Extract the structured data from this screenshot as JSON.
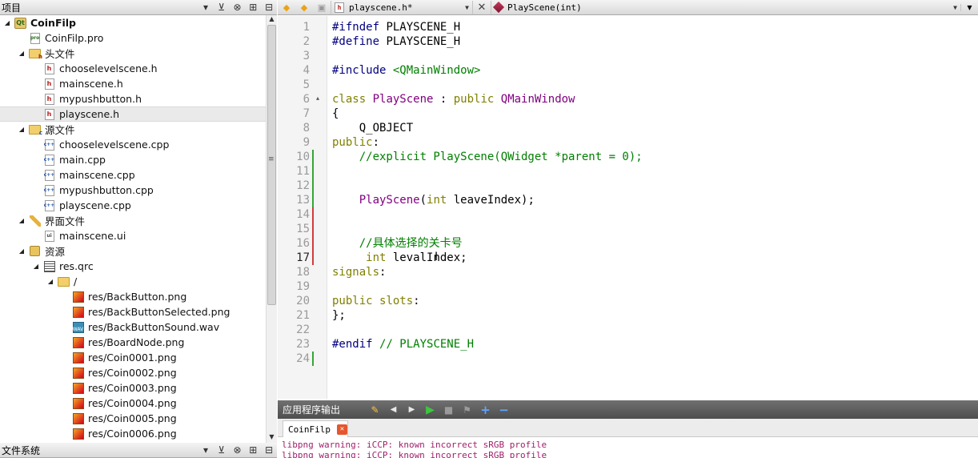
{
  "projects_panel": {
    "title": "项目",
    "tree": [
      {
        "label": "CoinFilp",
        "icon": "project-icon",
        "expanded": true
      },
      {
        "label": "CoinFilp.pro",
        "icon": "pro-file-icon"
      },
      {
        "label": "头文件",
        "icon": "headers-folder-icon",
        "expanded": true
      },
      {
        "label": "chooselevelscene.h",
        "icon": "header-file-icon"
      },
      {
        "label": "mainscene.h",
        "icon": "header-file-icon"
      },
      {
        "label": "mypushbutton.h",
        "icon": "header-file-icon"
      },
      {
        "label": "playscene.h",
        "icon": "header-file-icon",
        "selected": true
      },
      {
        "label": "源文件",
        "icon": "sources-folder-icon",
        "expanded": true
      },
      {
        "label": "chooselevelscene.cpp",
        "icon": "cpp-file-icon"
      },
      {
        "label": "main.cpp",
        "icon": "cpp-file-icon"
      },
      {
        "label": "mainscene.cpp",
        "icon": "cpp-file-icon"
      },
      {
        "label": "mypushbutton.cpp",
        "icon": "cpp-file-icon"
      },
      {
        "label": "playscene.cpp",
        "icon": "cpp-file-icon"
      },
      {
        "label": "界面文件",
        "icon": "forms-folder-icon",
        "expanded": true
      },
      {
        "label": "mainscene.ui",
        "icon": "ui-file-icon"
      },
      {
        "label": "资源",
        "icon": "resources-folder-icon",
        "expanded": true
      },
      {
        "label": "res.qrc",
        "icon": "qrc-file-icon",
        "expanded": true
      },
      {
        "label": "/",
        "icon": "folder-icon",
        "expanded": true
      },
      {
        "label": "res/BackButton.png",
        "icon": "png-file-icon"
      },
      {
        "label": "res/BackButtonSelected.png",
        "icon": "png-file-icon"
      },
      {
        "label": "res/BackButtonSound.wav",
        "icon": "wav-file-icon"
      },
      {
        "label": "res/BoardNode.png",
        "icon": "png-file-icon"
      },
      {
        "label": "res/Coin0001.png",
        "icon": "png-file-icon"
      },
      {
        "label": "res/Coin0002.png",
        "icon": "png-file-icon"
      },
      {
        "label": "res/Coin0003.png",
        "icon": "png-file-icon"
      },
      {
        "label": "res/Coin0004.png",
        "icon": "png-file-icon"
      },
      {
        "label": "res/Coin0005.png",
        "icon": "png-file-icon"
      },
      {
        "label": "res/Coin0006.png",
        "icon": "png-file-icon"
      }
    ]
  },
  "filesystem_panel": {
    "title": "文件系统"
  },
  "editor_toolbar": {
    "file_name": "playscene.h*",
    "symbol": "PlayScene(int)",
    "close_symbol": "✕"
  },
  "editor": {
    "current_line": 17,
    "lines": [
      {
        "n": "1",
        "tokens": [
          {
            "t": "#ifndef",
            "c": "pp"
          },
          {
            "t": " PLAYSCENE_H",
            "c": ""
          }
        ]
      },
      {
        "n": "2",
        "tokens": [
          {
            "t": "#define",
            "c": "pp"
          },
          {
            "t": " PLAYSCENE_H",
            "c": ""
          }
        ]
      },
      {
        "n": "3",
        "tokens": []
      },
      {
        "n": "4",
        "tokens": [
          {
            "t": "#include",
            "c": "pp"
          },
          {
            "t": " ",
            "c": ""
          },
          {
            "t": "<QMainWindow>",
            "c": "str"
          }
        ]
      },
      {
        "n": "5",
        "tokens": []
      },
      {
        "n": "6",
        "tokens": [
          {
            "t": "class",
            "c": "kw"
          },
          {
            "t": " ",
            "c": ""
          },
          {
            "t": "PlayScene",
            "c": "ty"
          },
          {
            "t": " : ",
            "c": ""
          },
          {
            "t": "public",
            "c": "kw"
          },
          {
            "t": " ",
            "c": ""
          },
          {
            "t": "QMainWindow",
            "c": "ty"
          }
        ]
      },
      {
        "n": "7",
        "tokens": [
          {
            "t": "{",
            "c": ""
          }
        ]
      },
      {
        "n": "8",
        "tokens": [
          {
            "t": "    Q_OBJECT",
            "c": ""
          }
        ]
      },
      {
        "n": "9",
        "tokens": [
          {
            "t": "public",
            "c": "kw"
          },
          {
            "t": ":",
            "c": ""
          }
        ]
      },
      {
        "n": "10",
        "tokens": [
          {
            "t": "    //explicit PlayScene(QWidget *parent = 0);",
            "c": "cm"
          }
        ]
      },
      {
        "n": "11",
        "tokens": []
      },
      {
        "n": "12",
        "tokens": []
      },
      {
        "n": "13",
        "tokens": [
          {
            "t": "    ",
            "c": ""
          },
          {
            "t": "PlayScene",
            "c": "ty"
          },
          {
            "t": "(",
            "c": ""
          },
          {
            "t": "int",
            "c": "kw"
          },
          {
            "t": " leaveIndex);",
            "c": ""
          }
        ]
      },
      {
        "n": "14",
        "tokens": []
      },
      {
        "n": "15",
        "tokens": []
      },
      {
        "n": "16",
        "tokens": [
          {
            "t": "    //具体选择的关卡号",
            "c": "cm"
          }
        ]
      },
      {
        "n": "17",
        "tokens": [
          {
            "t": "     ",
            "c": ""
          },
          {
            "t": "int",
            "c": "kw"
          },
          {
            "t": " levalIndex;",
            "c": ""
          }
        ]
      },
      {
        "n": "18",
        "tokens": [
          {
            "t": "signals",
            "c": "kw"
          },
          {
            "t": ":",
            "c": ""
          }
        ]
      },
      {
        "n": "19",
        "tokens": []
      },
      {
        "n": "20",
        "tokens": [
          {
            "t": "public",
            "c": "kw"
          },
          {
            "t": " ",
            "c": ""
          },
          {
            "t": "slots",
            "c": "kw"
          },
          {
            "t": ":",
            "c": ""
          }
        ]
      },
      {
        "n": "21",
        "tokens": [
          {
            "t": "};",
            "c": ""
          }
        ]
      },
      {
        "n": "22",
        "tokens": []
      },
      {
        "n": "23",
        "tokens": [
          {
            "t": "#endif",
            "c": "pp"
          },
          {
            "t": " ",
            "c": ""
          },
          {
            "t": "// PLAYSCENE_H",
            "c": "cm"
          }
        ]
      },
      {
        "n": "24",
        "tokens": []
      }
    ]
  },
  "output_panel": {
    "title": "应用程序输出",
    "tab_label": "CoinFilp",
    "lines": [
      "libpng warning: iCCP: known incorrect sRGB profile",
      "libpng warning: iCCP: known incorrect sRGB profile"
    ]
  },
  "colors": {
    "keyword": "#808000",
    "preprocessor": "#000080",
    "type": "#800080",
    "comment": "#008000",
    "output_text": "#a0206b",
    "change_added": "#36a535",
    "change_modified": "#d23a3a"
  }
}
